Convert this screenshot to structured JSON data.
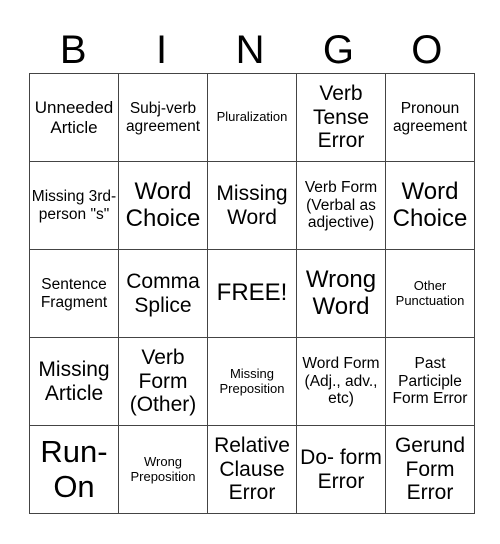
{
  "header": [
    "B",
    "I",
    "N",
    "G",
    "O"
  ],
  "rows": [
    [
      {
        "text": "Unneeded Article",
        "size": "s17"
      },
      {
        "text": "Subj-verb agreement",
        "size": "s15"
      },
      {
        "text": "Pluralization",
        "size": "s13"
      },
      {
        "text": "Verb Tense Error",
        "size": "s21"
      },
      {
        "text": "Pronoun agreement",
        "size": "s15"
      }
    ],
    [
      {
        "text": "Missing 3rd- person \"s\"",
        "size": "s15"
      },
      {
        "text": "Word Choice",
        "size": "s24"
      },
      {
        "text": "Missing Word",
        "size": "s21"
      },
      {
        "text": "Verb Form (Verbal as adjective)",
        "size": "s15"
      },
      {
        "text": "Word Choice",
        "size": "s24"
      }
    ],
    [
      {
        "text": "Sentence Fragment",
        "size": "s15"
      },
      {
        "text": "Comma Splice",
        "size": "s21"
      },
      {
        "text": "FREE!",
        "size": "s24"
      },
      {
        "text": "Wrong Word",
        "size": "s24"
      },
      {
        "text": "Other Punctuation",
        "size": "s13"
      }
    ],
    [
      {
        "text": "Missing Article",
        "size": "s21"
      },
      {
        "text": "Verb Form (Other)",
        "size": "s21"
      },
      {
        "text": "Missing Preposition",
        "size": "s13"
      },
      {
        "text": "Word Form (Adj., adv., etc)",
        "size": "s15"
      },
      {
        "text": "Past Participle Form Error",
        "size": "s15"
      }
    ],
    [
      {
        "text": "Run- On",
        "size": "s30"
      },
      {
        "text": "Wrong Preposition",
        "size": "s13"
      },
      {
        "text": "Relative Clause Error",
        "size": "s21"
      },
      {
        "text": "Do- form Error",
        "size": "s21"
      },
      {
        "text": "Gerund Form Error",
        "size": "s21"
      }
    ]
  ]
}
